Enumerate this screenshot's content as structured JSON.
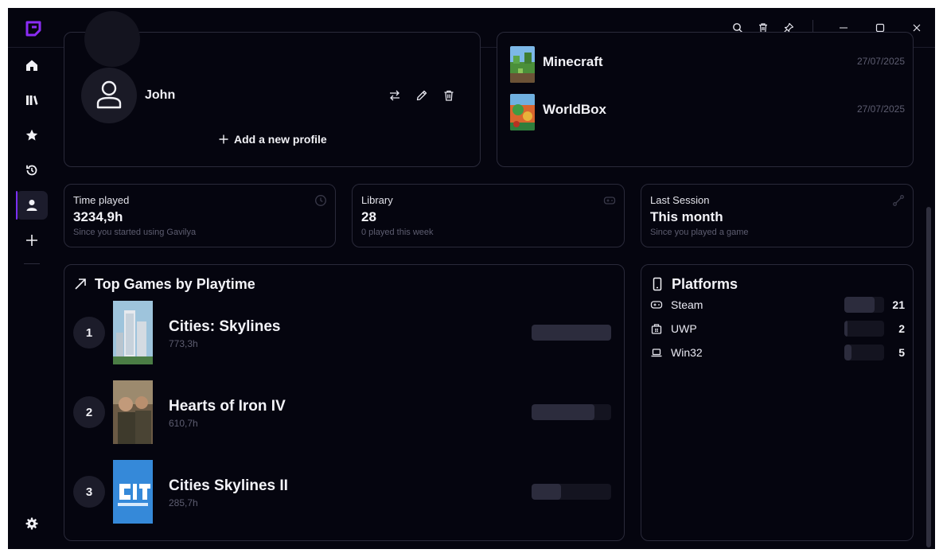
{
  "colors": {
    "accent": "#7b2ff7",
    "background": "#05050f",
    "card_border": "#2a2a3a",
    "bar_fill": "#2c2c3d"
  },
  "titlebar": {
    "logo_icon": "gavilya-logo",
    "actions": [
      "search-icon",
      "trash-icon",
      "pin-icon"
    ],
    "window_controls": [
      "minimize-icon",
      "maximize-icon",
      "close-icon"
    ]
  },
  "sidebar": {
    "items": [
      {
        "icon": "home-icon",
        "active": false
      },
      {
        "icon": "library-icon",
        "active": false
      },
      {
        "icon": "star-icon",
        "active": false
      },
      {
        "icon": "history-icon",
        "active": false
      },
      {
        "icon": "profile-icon",
        "active": true
      },
      {
        "icon": "plus-icon",
        "active": false
      }
    ],
    "settings_icon": "gear-icon"
  },
  "profiles": {
    "current": {
      "name": "John"
    },
    "actions": [
      "switch-icon",
      "edit-icon",
      "delete-icon"
    ],
    "add_label": "Add a new profile"
  },
  "recent": {
    "items": [
      {
        "name": "Minecraft",
        "date": "27/07/2025"
      },
      {
        "name": "WorldBox",
        "date": "27/07/2025"
      }
    ]
  },
  "stats": [
    {
      "label": "Time played",
      "value": "3234,9h",
      "sub": "Since you started using Gavilya",
      "icon": "clock-icon"
    },
    {
      "label": "Library",
      "value": "28",
      "sub": "0 played this week",
      "icon": "gamepad-icon"
    },
    {
      "label": "Last Session",
      "value": "This month",
      "sub": "Since you played a game",
      "icon": "route-icon"
    }
  ],
  "top_games": {
    "title": "Top Games by Playtime",
    "items": [
      {
        "rank": "1",
        "name": "Cities: Skylines",
        "hours": "773,3h",
        "share": 1.0
      },
      {
        "rank": "2",
        "name": "Hearts of Iron IV",
        "hours": "610,7h",
        "share": 0.79
      },
      {
        "rank": "3",
        "name": "Cities Skylines II",
        "hours": "285,7h",
        "share": 0.37
      }
    ]
  },
  "platforms": {
    "title": "Platforms",
    "items": [
      {
        "name": "Steam",
        "count": "21",
        "share": 0.75,
        "icon": "gamepad-icon"
      },
      {
        "name": "UWP",
        "count": "2",
        "share": 0.07,
        "icon": "store-icon"
      },
      {
        "name": "Win32",
        "count": "5",
        "share": 0.18,
        "icon": "laptop-icon"
      }
    ]
  }
}
